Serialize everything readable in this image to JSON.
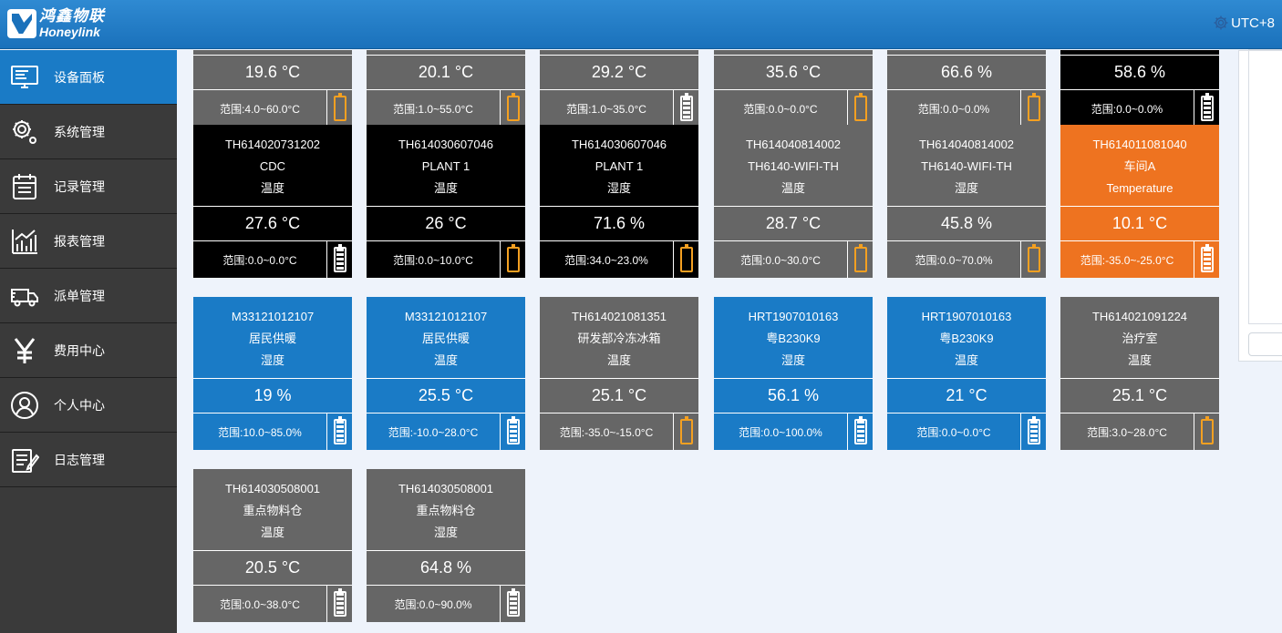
{
  "header": {
    "logo_cn": "鸿鑫物联",
    "logo_en": "Honeylink",
    "timezone": "UTC+8"
  },
  "sidebar": {
    "items": [
      {
        "label": "设备面板",
        "icon": "monitor-icon",
        "active": true
      },
      {
        "label": "系统管理",
        "icon": "gear-icon",
        "active": false
      },
      {
        "label": "记录管理",
        "icon": "calendar-icon",
        "active": false
      },
      {
        "label": "报表管理",
        "icon": "chart-icon",
        "active": false
      },
      {
        "label": "派单管理",
        "icon": "truck-icon",
        "active": false
      },
      {
        "label": "费用中心",
        "icon": "yen-icon",
        "active": false
      },
      {
        "label": "个人中心",
        "icon": "user-icon",
        "active": false
      },
      {
        "label": "日志管理",
        "icon": "log-icon",
        "active": false
      }
    ]
  },
  "cards": [
    {
      "id": "",
      "name": "",
      "type": "",
      "value": "19.6 °C",
      "range": "范围:4.0~60.0°C",
      "color": "gray",
      "battery": "low"
    },
    {
      "id": "",
      "name": "",
      "type": "",
      "value": "20.1 °C",
      "range": "范围:1.0~55.0°C",
      "color": "gray",
      "battery": "low"
    },
    {
      "id": "",
      "name": "",
      "type": "",
      "value": "29.2 °C",
      "range": "范围:1.0~35.0°C",
      "color": "gray",
      "battery": "full"
    },
    {
      "id": "",
      "name": "",
      "type": "",
      "value": "35.6 °C",
      "range": "范围:0.0~0.0°C",
      "color": "gray",
      "battery": "low"
    },
    {
      "id": "",
      "name": "",
      "type": "",
      "value": "66.6 %",
      "range": "范围:0.0~0.0%",
      "color": "gray",
      "battery": "low"
    },
    {
      "id": "",
      "name": "",
      "type": "",
      "value": "58.6 %",
      "range": "范围:0.0~0.0%",
      "color": "black",
      "battery": "full"
    },
    {
      "id": "TH614020731202",
      "name": "CDC",
      "type": "温度",
      "value": "27.6 °C",
      "range": "范围:0.0~0.0°C",
      "color": "black",
      "battery": "full"
    },
    {
      "id": "TH614030607046",
      "name": "PLANT 1",
      "type": "温度",
      "value": "26 °C",
      "range": "范围:0.0~10.0°C",
      "color": "black",
      "battery": "low"
    },
    {
      "id": "TH614030607046",
      "name": "PLANT 1",
      "type": "湿度",
      "value": "71.6 %",
      "range": "范围:34.0~23.0%",
      "color": "black",
      "battery": "low"
    },
    {
      "id": "TH614040814002",
      "name": "TH6140-WIFI-TH",
      "type": "温度",
      "value": "28.7 °C",
      "range": "范围:0.0~30.0°C",
      "color": "gray",
      "battery": "low"
    },
    {
      "id": "TH614040814002",
      "name": "TH6140-WIFI-TH",
      "type": "湿度",
      "value": "45.8 %",
      "range": "范围:0.0~70.0%",
      "color": "gray",
      "battery": "low"
    },
    {
      "id": "TH614011081040",
      "name": "车间A",
      "type": "Temperature",
      "value": "10.1 °C",
      "range": "范围:-35.0~-25.0°C",
      "color": "orange",
      "battery": "full"
    },
    {
      "id": "M33121012107",
      "name": "居民供暖",
      "type": "湿度",
      "value": "19 %",
      "range": "范围:10.0~85.0%",
      "color": "blue",
      "battery": "full"
    },
    {
      "id": "M33121012107",
      "name": "居民供暖",
      "type": "温度",
      "value": "25.5 °C",
      "range": "范围:-10.0~28.0°C",
      "color": "blue",
      "battery": "full"
    },
    {
      "id": "TH614021081351",
      "name": "研发部冷冻冰箱",
      "type": "温度",
      "value": "25.1 °C",
      "range": "范围:-35.0~-15.0°C",
      "color": "gray",
      "battery": "low"
    },
    {
      "id": "HRT1907010163",
      "name": "粤B230K9",
      "type": "湿度",
      "value": "56.1 %",
      "range": "范围:0.0~100.0%",
      "color": "blue",
      "battery": "full"
    },
    {
      "id": "HRT1907010163",
      "name": "粤B230K9",
      "type": "温度",
      "value": "21 °C",
      "range": "范围:0.0~0.0°C",
      "color": "blue",
      "battery": "full"
    },
    {
      "id": "TH614021091224",
      "name": "治疗室",
      "type": "温度",
      "value": "25.1 °C",
      "range": "范围:3.0~28.0°C",
      "color": "gray",
      "battery": "low"
    },
    {
      "id": "TH614030508001",
      "name": "重点物料仓",
      "type": "温度",
      "value": "20.5 °C",
      "range": "范围:0.0~38.0°C",
      "color": "gray",
      "battery": "full"
    },
    {
      "id": "TH614030508001",
      "name": "重点物料仓",
      "type": "湿度",
      "value": "64.8 %",
      "range": "范围:0.0~90.0%",
      "color": "gray",
      "battery": "full"
    }
  ]
}
